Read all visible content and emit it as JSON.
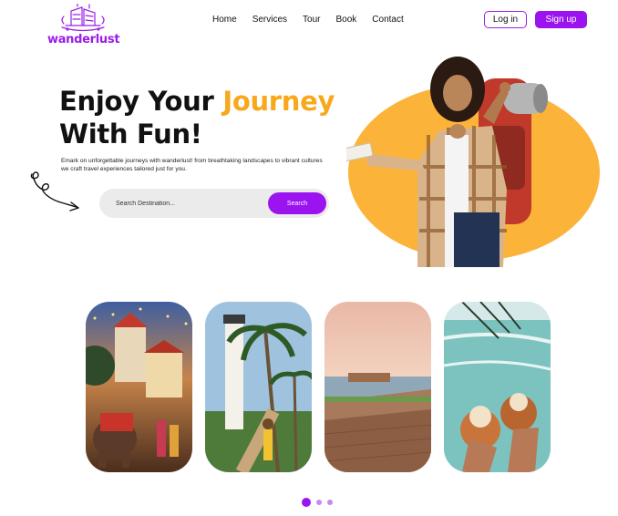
{
  "brand": {
    "name": "wanderlust",
    "color": "#9b1de8"
  },
  "nav": {
    "items": [
      {
        "label": "Home"
      },
      {
        "label": "Services"
      },
      {
        "label": "Tour"
      },
      {
        "label": "Book"
      },
      {
        "label": "Contact"
      }
    ]
  },
  "auth": {
    "login_label": "Log in",
    "signup_label": "Sign up"
  },
  "hero": {
    "title_part1": "Enjoy Your ",
    "title_accent": "Journey",
    "title_part2": "With Fun!",
    "description": "Emark on unforgettable journeys with wanderlust! from breathtaking landscapes to vibrant cultures we craft travel experiences tailored just for you.",
    "accent_color": "#f7a81b"
  },
  "search": {
    "placeholder": "Search Destination...",
    "button_label": "Search"
  },
  "gallery": {
    "cards": [
      {
        "name": "temple-festival-elephants"
      },
      {
        "name": "lighthouse-palm-trees"
      },
      {
        "name": "coastal-fort-sunset"
      },
      {
        "name": "coconuts-beach"
      }
    ],
    "pagination": {
      "total": 3,
      "active": 1
    }
  },
  "icons": {
    "arrow": "curly-arrow-icon",
    "logo": "ship-logo-icon"
  }
}
